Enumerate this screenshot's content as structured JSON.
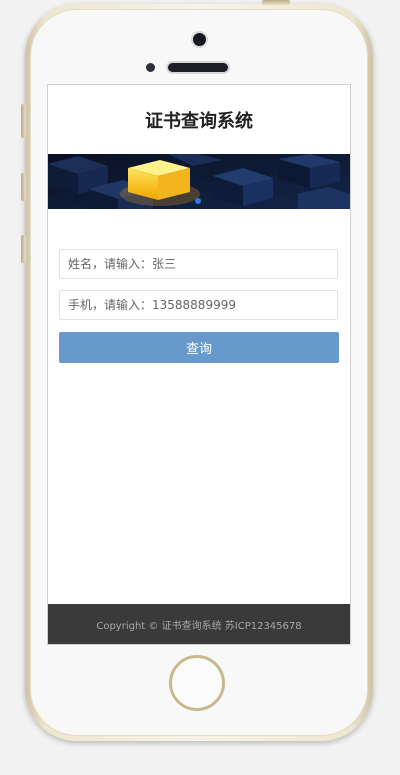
{
  "app": {
    "title": "证书查询系统"
  },
  "form": {
    "name_placeholder": "姓名，请输入：张三",
    "phone_placeholder": "手机，请输入：13588889999",
    "query_label": "查询"
  },
  "carousel": {
    "active_index": 0,
    "slide_count": 1
  },
  "footer": {
    "text": "Copyright © 证书查询系统 苏ICP12345678"
  },
  "colors": {
    "button": "#6799cc",
    "footer_bg": "#3a3a3a",
    "carousel_dot": "#2f7ad8"
  }
}
